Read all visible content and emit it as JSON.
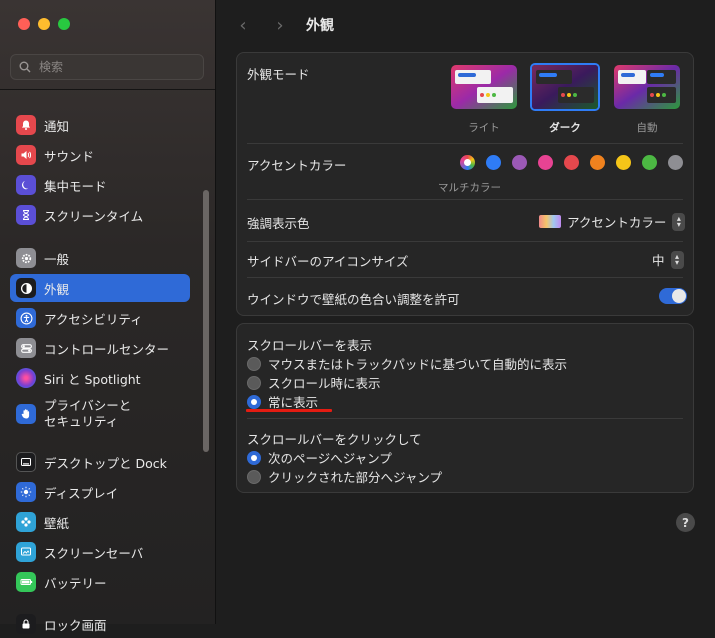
{
  "search": {
    "placeholder": "検索"
  },
  "sidebar": {
    "items": [
      {
        "label": "通知",
        "icon": "bell-icon",
        "color": "#e5484d"
      },
      {
        "label": "サウンド",
        "icon": "speaker-icon",
        "color": "#e5484d"
      },
      {
        "label": "集中モード",
        "icon": "moon-icon",
        "color": "#5b4fd6"
      },
      {
        "label": "スクリーンタイム",
        "icon": "hourglass-icon",
        "color": "#5b4fd6"
      },
      {
        "label": "一般",
        "icon": "gear-icon",
        "color": "#8e8e93"
      },
      {
        "label": "外観",
        "icon": "appearance-icon",
        "color": "#1c1c1e"
      },
      {
        "label": "アクセシビリティ",
        "icon": "accessibility-icon",
        "color": "#2f6ad7"
      },
      {
        "label": "コントロールセンター",
        "icon": "control-center-icon",
        "color": "#8e8e93"
      },
      {
        "label": "Siri と Spotlight",
        "icon": "siri-icon",
        "color": "#7a3fd1"
      },
      {
        "label": "プライバシーと",
        "label2": "セキュリティ",
        "icon": "hand-icon",
        "color": "#2f6ad7"
      },
      {
        "label": "デスクトップと Dock",
        "icon": "dock-icon",
        "color": "#1c1c1e"
      },
      {
        "label": "ディスプレイ",
        "icon": "display-icon",
        "color": "#2f6ad7"
      },
      {
        "label": "壁紙",
        "icon": "wallpaper-icon",
        "color": "#2fa3d7"
      },
      {
        "label": "スクリーンセーバ",
        "icon": "screensaver-icon",
        "color": "#2fa3d7"
      },
      {
        "label": "バッテリー",
        "icon": "battery-icon",
        "color": "#34c759"
      },
      {
        "label": "ロック画面",
        "icon": "lock-icon",
        "color": "#1c1c1e"
      }
    ]
  },
  "header": {
    "title": "外観"
  },
  "appearance": {
    "label": "外観モード",
    "options": [
      {
        "label": "ライト",
        "selected": false
      },
      {
        "label": "ダーク",
        "selected": true
      },
      {
        "label": "自動",
        "selected": false
      }
    ]
  },
  "accent": {
    "label": "アクセントカラー",
    "multicolor_label": "マルチカラー",
    "colors": [
      "#2f7cf6",
      "#9b59b6",
      "#e84393",
      "#e5484d",
      "#f0821e",
      "#f5c518",
      "#4cb843",
      "#8e8e93"
    ]
  },
  "highlight": {
    "label": "強調表示色",
    "value": "アクセントカラー"
  },
  "sidebar_icon_size": {
    "label": "サイドバーのアイコンサイズ",
    "value": "中"
  },
  "wallpaper_tint": {
    "label": "ウインドウで壁紙の色合い調整を許可",
    "enabled": true
  },
  "scrollbars": {
    "label": "スクロールバーを表示",
    "options": [
      {
        "label": "マウスまたはトラックパッドに基づいて自動的に表示",
        "selected": false
      },
      {
        "label": "スクロール時に表示",
        "selected": false
      },
      {
        "label": "常に表示",
        "selected": true
      }
    ]
  },
  "click_scroll": {
    "label": "スクロールバーをクリックして",
    "options": [
      {
        "label": "次のページへジャンプ",
        "selected": true
      },
      {
        "label": "クリックされた部分へジャンプ",
        "selected": false
      }
    ]
  },
  "help": {
    "label": "?"
  }
}
